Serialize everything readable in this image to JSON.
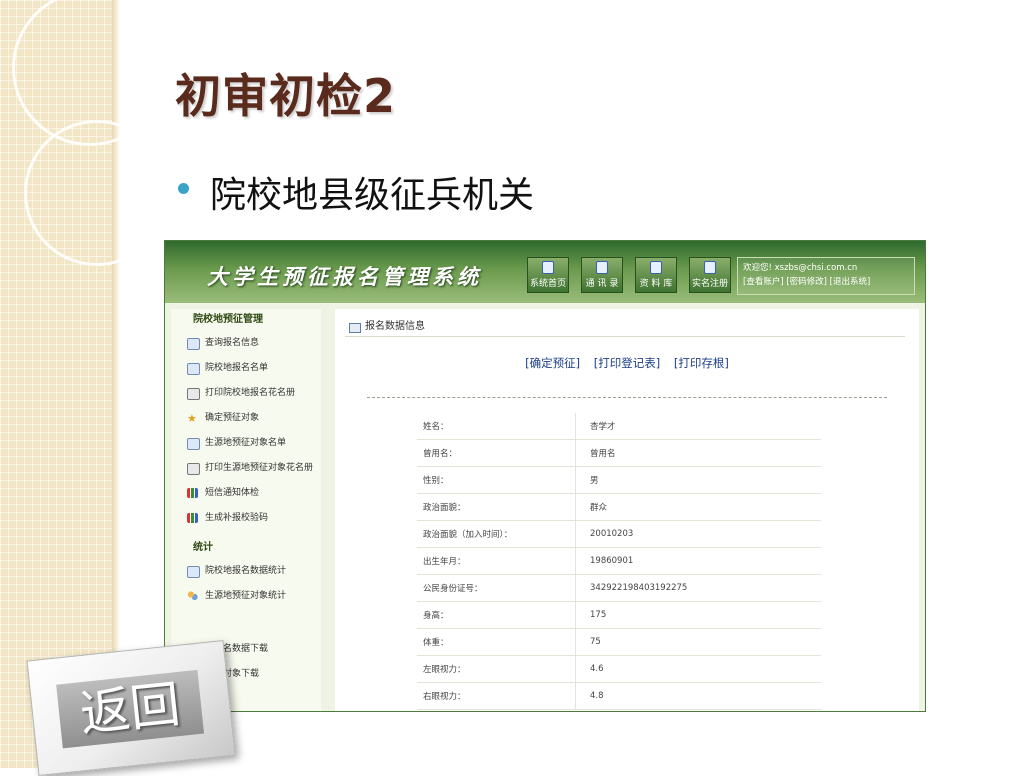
{
  "slide": {
    "title": "初审初检2",
    "bullet": "院校地县级征兵机关",
    "return_button": "返回"
  },
  "app": {
    "system_title": "大学生预征报名管理系统",
    "nav": [
      "系统首页",
      "通 讯 录",
      "资 料 库",
      "实名注册"
    ],
    "welcome": {
      "greeting": "欢迎您! xszbs@chsi.com.cn",
      "links": "[查看账户] [密码修改] [退出系统]"
    },
    "sidebar": {
      "section1": "院校地预征管理",
      "items1": [
        {
          "label": "查询报名信息",
          "icon": "search-list-icon"
        },
        {
          "label": "院校地报名名单",
          "icon": "document-icon"
        },
        {
          "label": "打印院校地报名花名册",
          "icon": "printer-icon"
        },
        {
          "label": "确定预征对象",
          "icon": "star-medal-icon"
        },
        {
          "label": "生源地预征对象名单",
          "icon": "document-icon"
        },
        {
          "label": "打印生源地预征对象花名册",
          "icon": "printer-icon"
        },
        {
          "label": "短信通知体检",
          "icon": "bar-chart-icon"
        },
        {
          "label": "生成补报校验码",
          "icon": "bar-chart-icon"
        }
      ],
      "section2": "统计",
      "items2": [
        {
          "label": "院校地报名数据统计",
          "icon": "chart-icon"
        },
        {
          "label": "生源地预征对象统计",
          "icon": "people-icon"
        }
      ],
      "items3": [
        {
          "label": "地报名数据下载"
        },
        {
          "label": "预征对象下载"
        }
      ]
    },
    "main": {
      "breadcrumb": "报名数据信息",
      "actions": [
        "[确定预征]",
        "[打印登记表]",
        "[打印存根]"
      ],
      "rows": [
        {
          "label": "姓名：",
          "value": "杏学才"
        },
        {
          "label": "曾用名：",
          "value": "曾用名"
        },
        {
          "label": "性别：",
          "value": "男"
        },
        {
          "label": "政治面貌：",
          "value": "群众"
        },
        {
          "label": "政治面貌（加入时间）：",
          "value": "20010203"
        },
        {
          "label": "出生年月：",
          "value": "19860901"
        },
        {
          "label": "公民身份证号：",
          "value": "342922198403192275"
        },
        {
          "label": "身高：",
          "value": "175"
        },
        {
          "label": "体重：",
          "value": "75"
        },
        {
          "label": "左眼视力：",
          "value": "4.6"
        },
        {
          "label": "右眼视力：",
          "value": "4.8"
        }
      ]
    }
  }
}
